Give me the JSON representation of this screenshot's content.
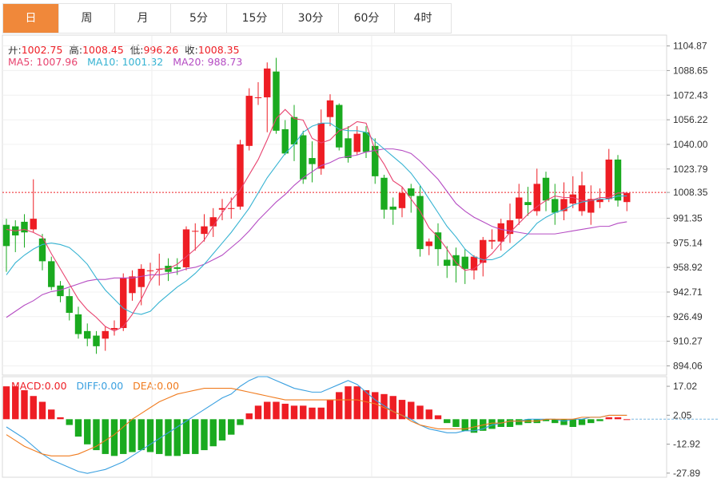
{
  "tabs": [
    {
      "label": "日",
      "active": true
    },
    {
      "label": "周",
      "active": false
    },
    {
      "label": "月",
      "active": false
    },
    {
      "label": "5分",
      "active": false
    },
    {
      "label": "15分",
      "active": false
    },
    {
      "label": "30分",
      "active": false
    },
    {
      "label": "60分",
      "active": false
    },
    {
      "label": "4时",
      "active": false
    }
  ],
  "ohlc_info": {
    "open_label": "开:",
    "open": "1002.75",
    "high_label": "高:",
    "high": "1008.45",
    "low_label": "低:",
    "low": "996.26",
    "close_label": "收:",
    "close": "1008.35"
  },
  "ma_info": {
    "ma5_label": "MA5:",
    "ma5": "1007.96",
    "ma10_label": "MA10:",
    "ma10": "1001.32",
    "ma20_label": "MA20:",
    "ma20": "988.73"
  },
  "macd_info": {
    "macd_label": "MACD:",
    "macd": "0.00",
    "diff_label": "DIFF:",
    "diff": "0.00",
    "dea_label": "DEA:",
    "dea": "0.00"
  },
  "colors": {
    "up": "#ee1d24",
    "down": "#1aaa1f",
    "ma5": "#e8436f",
    "ma10": "#36b3d2",
    "ma20": "#b54cc3",
    "diff": "#3aa0e0",
    "dea": "#f07b1e",
    "tab_active": "#f0883a"
  },
  "chart_data": {
    "type": "candlestick",
    "price_axis": {
      "ticks": [
        "1104.87",
        "1088.65",
        "1072.43",
        "1056.22",
        "1040.00",
        "1023.79",
        "1008.35",
        "991.35",
        "975.14",
        "958.92",
        "942.71",
        "926.49",
        "910.27",
        "894.06"
      ],
      "range": [
        888,
        1112
      ],
      "current_price": 1008.35
    },
    "macd_axis": {
      "ticks": [
        "17.02",
        "2.05",
        "-12.92",
        "-27.89"
      ],
      "range": [
        -30,
        22
      ]
    },
    "candles": [
      [
        987,
        973,
        991,
        956
      ],
      [
        986,
        980,
        990,
        969
      ],
      [
        989,
        982,
        994,
        972
      ],
      [
        984,
        991,
        1017,
        982
      ],
      [
        978,
        963,
        981,
        957
      ],
      [
        963,
        946,
        966,
        944
      ],
      [
        947,
        940,
        950,
        936
      ],
      [
        940,
        929,
        945,
        924
      ],
      [
        928,
        915,
        933,
        912
      ],
      [
        917,
        912,
        922,
        907
      ],
      [
        914,
        907,
        917,
        902
      ],
      [
        912,
        917,
        920,
        904
      ],
      [
        918,
        919,
        924,
        914
      ],
      [
        919,
        952,
        955,
        917
      ],
      [
        942,
        953,
        957,
        937
      ],
      [
        946,
        958,
        961,
        934
      ],
      [
        957,
        957,
        962,
        951
      ],
      [
        958,
        958,
        968,
        947
      ],
      [
        960,
        956,
        965,
        950
      ],
      [
        959,
        958,
        965,
        954
      ],
      [
        959,
        984,
        986,
        957
      ],
      [
        983,
        983,
        988,
        970
      ],
      [
        981,
        986,
        994,
        976
      ],
      [
        986,
        992,
        998,
        979
      ],
      [
        997,
        998,
        1004,
        990
      ],
      [
        998,
        998,
        1005,
        991
      ],
      [
        999,
        1040,
        1043,
        997
      ],
      [
        1039,
        1072,
        1077,
        1036
      ],
      [
        1071,
        1071,
        1081,
        1066
      ],
      [
        1071,
        1090,
        1094,
        1048
      ],
      [
        1088,
        1049,
        1097,
        1047
      ],
      [
        1050,
        1034,
        1056,
        1033
      ],
      [
        1058,
        1040,
        1066,
        1029
      ],
      [
        1046,
        1017,
        1049,
        1014
      ],
      [
        1031,
        1027,
        1042,
        1015
      ],
      [
        1024,
        1054,
        1063,
        1020
      ],
      [
        1058,
        1069,
        1073,
        1052
      ],
      [
        1066,
        1038,
        1067,
        1036
      ],
      [
        1044,
        1031,
        1052,
        1028
      ],
      [
        1035,
        1047,
        1052,
        1033
      ],
      [
        1048,
        1035,
        1052,
        1031
      ],
      [
        1039,
        1019,
        1044,
        1014
      ],
      [
        1018,
        997,
        1020,
        991
      ],
      [
        999,
        997,
        1005,
        987
      ],
      [
        998,
        1008,
        1012,
        992
      ],
      [
        1011,
        1006,
        1014,
        995
      ],
      [
        1006,
        971,
        1013,
        966
      ],
      [
        973,
        976,
        978,
        967
      ],
      [
        982,
        971,
        988,
        960
      ],
      [
        964,
        960,
        973,
        952
      ],
      [
        967,
        960,
        972,
        949
      ],
      [
        966,
        958,
        971,
        948
      ],
      [
        957,
        966,
        967,
        951
      ],
      [
        962,
        977,
        979,
        953
      ],
      [
        976,
        977,
        984,
        971
      ],
      [
        976,
        988,
        991,
        970
      ],
      [
        981,
        990,
        1001,
        975
      ],
      [
        991,
        1005,
        1014,
        987
      ],
      [
        1002,
        1000,
        1012,
        993
      ],
      [
        996,
        1014,
        1024,
        993
      ],
      [
        1018,
        1003,
        1022,
        996
      ],
      [
        1004,
        995,
        1014,
        987
      ],
      [
        996,
        1004,
        1015,
        990
      ],
      [
        1001,
        1007,
        1019,
        998
      ],
      [
        996,
        1013,
        1022,
        993
      ],
      [
        995,
        1004,
        1013,
        987
      ],
      [
        1002,
        1004,
        1011,
        998
      ],
      [
        1004,
        1030,
        1037,
        1002
      ],
      [
        1030,
        1003,
        1033,
        999
      ],
      [
        1002,
        1008,
        1008,
        996
      ]
    ],
    "ma5": [
      984,
      983,
      984,
      982,
      979,
      968,
      958,
      948,
      938,
      931,
      926,
      920,
      917,
      920,
      928,
      938,
      950,
      958,
      958,
      961,
      966,
      971,
      977,
      986,
      995,
      1003,
      1010,
      1020,
      1030,
      1043,
      1057,
      1063,
      1057,
      1056,
      1044,
      1041,
      1043,
      1049,
      1051,
      1055,
      1054,
      1036,
      1027,
      1016,
      1012,
      1004,
      996,
      985,
      979,
      971,
      962,
      957,
      958,
      963,
      968,
      975,
      982,
      988,
      994,
      999,
      1003,
      1006,
      1005,
      1005,
      1003,
      1003,
      1005,
      1005,
      1008,
      1008
    ],
    "ma10": [
      954,
      962,
      967,
      971,
      974,
      975,
      974,
      972,
      967,
      961,
      952,
      944,
      938,
      932,
      929,
      928,
      930,
      936,
      941,
      946,
      950,
      955,
      961,
      968,
      975,
      982,
      990,
      998,
      1008,
      1018,
      1026,
      1034,
      1040,
      1048,
      1052,
      1054,
      1054,
      1050,
      1049,
      1049,
      1048,
      1042,
      1037,
      1032,
      1027,
      1021,
      1013,
      1004,
      995,
      986,
      979,
      971,
      966,
      964,
      964,
      966,
      971,
      976,
      981,
      988,
      992,
      995,
      997,
      1000,
      1002,
      1003,
      1004,
      1004,
      1006,
      1006
    ],
    "ma20": [
      926,
      930,
      934,
      937,
      941,
      943,
      944,
      946,
      948,
      950,
      951,
      951,
      952,
      952,
      952,
      953,
      954,
      954,
      955,
      956,
      958,
      959,
      961,
      964,
      967,
      972,
      977,
      983,
      990,
      996,
      1002,
      1007,
      1013,
      1018,
      1022,
      1026,
      1028,
      1031,
      1032,
      1033,
      1035,
      1036,
      1037,
      1037,
      1036,
      1034,
      1029,
      1023,
      1017,
      1009,
      1001,
      996,
      992,
      989,
      986,
      984,
      983,
      982,
      981,
      981,
      981,
      981,
      982,
      983,
      984,
      985,
      986,
      986,
      988,
      989
    ],
    "macd_hist": [
      17,
      17,
      15,
      12,
      9,
      5,
      1,
      -3,
      -9,
      -13,
      -16,
      -18,
      -19,
      -18,
      -17,
      -16,
      -17,
      -18,
      -19,
      -19,
      -18,
      -18,
      -16,
      -14,
      -11,
      -8,
      -3,
      3,
      7,
      9,
      9,
      8,
      7,
      7,
      6,
      6,
      10,
      14,
      17,
      17,
      15,
      14,
      13,
      12,
      10,
      9,
      7,
      5,
      2,
      -2,
      -4,
      -6,
      -7,
      -6,
      -5,
      -4,
      -4,
      -3,
      -2,
      -2,
      -1,
      -2,
      -3,
      -4,
      -3,
      -2,
      -1,
      1,
      1,
      0
    ],
    "diff": [
      -4,
      -7,
      -10,
      -14,
      -18,
      -21,
      -23,
      -25,
      -27,
      -28,
      -27,
      -26,
      -24,
      -22,
      -19,
      -16,
      -13,
      -10,
      -7,
      -4,
      -1,
      2,
      5,
      8,
      11,
      13,
      17,
      20,
      22,
      22,
      20,
      18,
      16,
      15,
      14,
      14,
      16,
      18,
      20,
      18,
      14,
      10,
      7,
      4,
      2,
      0,
      -3,
      -5,
      -6,
      -7,
      -7,
      -6,
      -6,
      -5,
      -3,
      -2,
      -1,
      -1,
      0,
      0,
      0,
      0,
      -1,
      0,
      0,
      1,
      1,
      2,
      2,
      2
    ],
    "dea": [
      -8,
      -11,
      -14,
      -16,
      -18,
      -19,
      -19,
      -19,
      -18,
      -16,
      -14,
      -11,
      -8,
      -4,
      0,
      3,
      6,
      9,
      11,
      13,
      14,
      15,
      16,
      16,
      16,
      16,
      15,
      14,
      13,
      12,
      11,
      10,
      10,
      10,
      10,
      10,
      10,
      10,
      10,
      10,
      9,
      8,
      6,
      4,
      2,
      -1,
      -3,
      -4,
      -5,
      -5,
      -5,
      -5,
      -4,
      -3,
      -2,
      -2,
      -1,
      -1,
      -1,
      -1,
      0,
      0,
      0,
      0,
      1,
      1,
      1,
      2,
      2,
      2
    ]
  }
}
